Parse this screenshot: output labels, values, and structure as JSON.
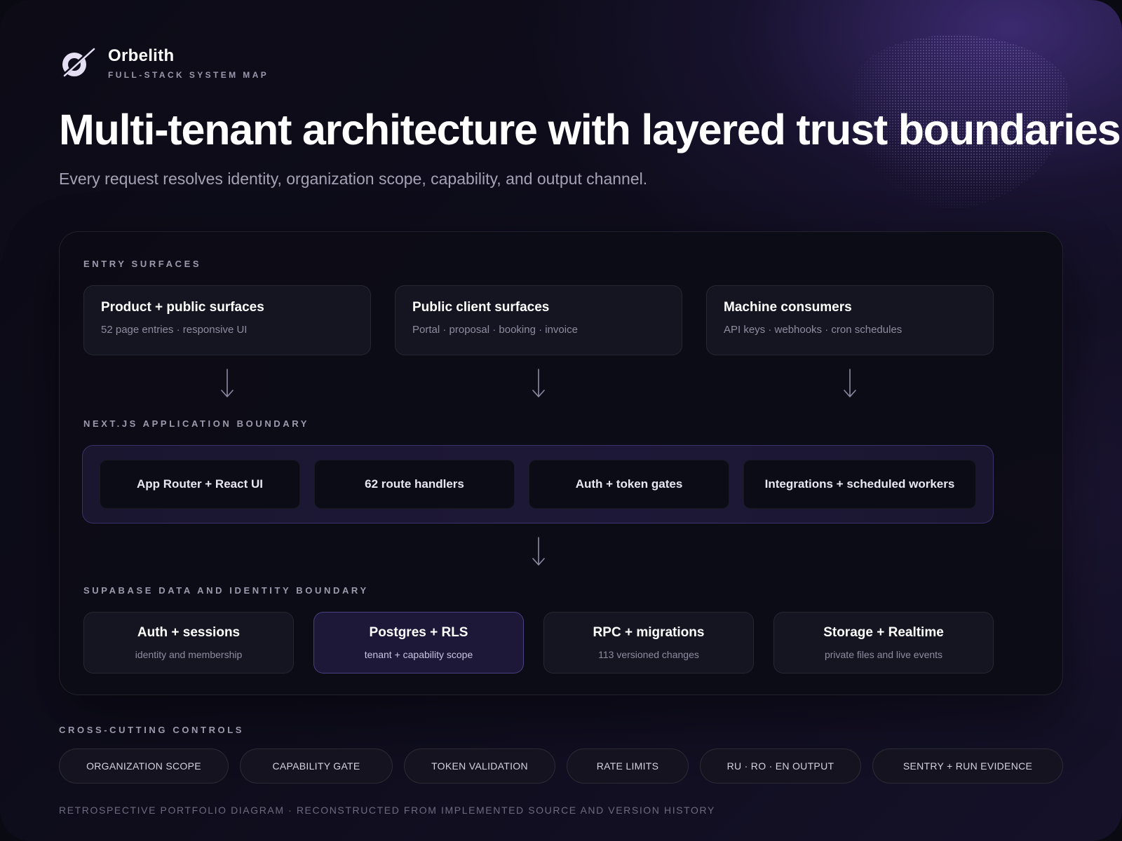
{
  "brand": {
    "name": "Orbelith",
    "subtitle": "FULL-STACK SYSTEM MAP",
    "icon": "orbit-logo-icon"
  },
  "headline": "Multi-tenant architecture with layered trust boundaries",
  "subheadline": "Every request resolves identity, organization scope, capability, and output channel.",
  "entry": {
    "label": "ENTRY SURFACES",
    "cards": [
      {
        "title": "Product + public surfaces",
        "subtitle": "52 page entries · responsive UI"
      },
      {
        "title": "Public client surfaces",
        "subtitle": "Portal · proposal · booking · invoice"
      },
      {
        "title": "Machine consumers",
        "subtitle": "API keys · webhooks · cron schedules"
      }
    ]
  },
  "app_boundary": {
    "label": "NEXT.JS APPLICATION BOUNDARY",
    "chips": [
      "App Router + React UI",
      "62 route handlers",
      "Auth + token gates",
      "Integrations + scheduled workers"
    ]
  },
  "data_boundary": {
    "label": "SUPABASE DATA AND IDENTITY BOUNDARY",
    "cards": [
      {
        "title": "Auth + sessions",
        "subtitle": "identity and membership"
      },
      {
        "title": "Postgres + RLS",
        "subtitle": "tenant + capability scope"
      },
      {
        "title": "RPC + migrations",
        "subtitle": "113 versioned changes"
      },
      {
        "title": "Storage + Realtime",
        "subtitle": "private files and live events"
      }
    ]
  },
  "controls": {
    "label": "CROSS-CUTTING CONTROLS",
    "items": [
      "ORGANIZATION SCOPE",
      "CAPABILITY GATE",
      "TOKEN VALIDATION",
      "RATE LIMITS",
      "RU · RO · EN OUTPUT",
      "SENTRY + RUN EVIDENCE"
    ]
  },
  "footer": "RETROSPECTIVE PORTFOLIO DIAGRAM · RECONSTRUCTED FROM IMPLEMENTED SOURCE AND VERSION HISTORY",
  "colors": {
    "background": "#0c0b16",
    "accent": "#4a348c",
    "highlight_card": "#1d1838"
  }
}
